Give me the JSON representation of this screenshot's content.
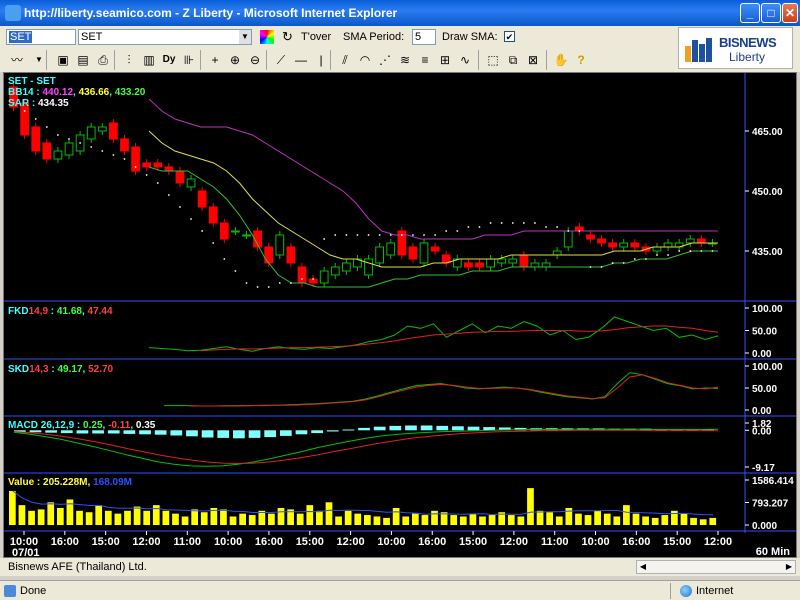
{
  "window": {
    "title": "http://liberty.seamico.com - Z Liberty - Microsoft Internet Explorer",
    "minimize": "_",
    "maximize": "□",
    "close": "✕"
  },
  "toolbar": {
    "symbol_input": "SET",
    "symbol_select": "SET",
    "tover_label": "T'over",
    "sma_period_label": "SMA Period:",
    "sma_period_value": "5",
    "draw_sma_label": "Draw SMA:",
    "draw_sma_checked": true,
    "icons": [
      "line-tool-icon",
      "dropdown-icon",
      "save-icon",
      "open-icon",
      "print-icon",
      "candle-icon",
      "bar-chart-icon",
      "date-icon",
      "crosshair-icon",
      "zoom-in-icon",
      "zoom-out-icon",
      "trendline-icon",
      "horizontal-line-icon",
      "vertical-line-icon",
      "parallel-lines-icon",
      "arc-icon",
      "fan-icon",
      "fibonacci-icon",
      "gann-icon",
      "cycle-icon",
      "select-icon",
      "copy-icon",
      "hand-icon",
      "help-icon"
    ]
  },
  "logo": {
    "brand": "BISNEWS",
    "sub": "Liberty"
  },
  "chart_data": [
    {
      "type": "line",
      "panel": "price",
      "labels": [
        "SET - SET",
        "BB14 : ",
        "SAR : "
      ],
      "legend": {
        "title": "SET - SET",
        "bb_label": "BB14 : ",
        "bb_values": [
          "440.12",
          "436.66",
          "433.20"
        ],
        "sar_label": "SAR : ",
        "sar_value": "434.35"
      },
      "y_ticks": [
        "465.00",
        "450.00",
        "435.00"
      ],
      "ylim": [
        424,
        478
      ],
      "candles": [
        {
          "o": 476,
          "c": 471
        },
        {
          "o": 472,
          "c": 464
        },
        {
          "o": 466,
          "c": 460
        },
        {
          "o": 462,
          "c": 458
        },
        {
          "o": 458,
          "c": 460
        },
        {
          "o": 459,
          "c": 462
        },
        {
          "o": 460,
          "c": 464
        },
        {
          "o": 463,
          "c": 466
        },
        {
          "o": 465,
          "c": 466
        },
        {
          "o": 467,
          "c": 463
        },
        {
          "o": 463,
          "c": 460
        },
        {
          "o": 461,
          "c": 455
        },
        {
          "o": 457,
          "c": 456
        },
        {
          "o": 457,
          "c": 456
        },
        {
          "o": 456,
          "c": 455
        },
        {
          "o": 455,
          "c": 452
        },
        {
          "o": 451,
          "c": 453
        },
        {
          "o": 450,
          "c": 446
        },
        {
          "o": 446,
          "c": 442
        },
        {
          "o": 442,
          "c": 438
        },
        {
          "o": 440,
          "c": 440
        },
        {
          "o": 439,
          "c": 439
        },
        {
          "o": 440,
          "c": 436
        },
        {
          "o": 436,
          "c": 432
        },
        {
          "o": 434,
          "c": 439
        },
        {
          "o": 436,
          "c": 432
        },
        {
          "o": 431,
          "c": 427
        },
        {
          "o": 428,
          "c": 427
        },
        {
          "o": 427,
          "c": 430
        },
        {
          "o": 429,
          "c": 431
        },
        {
          "o": 430,
          "c": 432
        },
        {
          "o": 431,
          "c": 433
        },
        {
          "o": 429,
          "c": 433
        },
        {
          "o": 432,
          "c": 436
        },
        {
          "o": 434,
          "c": 437
        },
        {
          "o": 440,
          "c": 434
        },
        {
          "o": 436,
          "c": 433
        },
        {
          "o": 432,
          "c": 437
        },
        {
          "o": 436,
          "c": 435
        },
        {
          "o": 434,
          "c": 432
        },
        {
          "o": 431,
          "c": 433
        },
        {
          "o": 432,
          "c": 431
        },
        {
          "o": 432,
          "c": 431
        },
        {
          "o": 431,
          "c": 433
        },
        {
          "o": 432,
          "c": 433
        },
        {
          "o": 432,
          "c": 433
        },
        {
          "o": 434,
          "c": 431
        },
        {
          "o": 431,
          "c": 432
        },
        {
          "o": 431,
          "c": 432
        },
        {
          "o": 434,
          "c": 435
        },
        {
          "o": 436,
          "c": 440
        },
        {
          "o": 441,
          "c": 440
        },
        {
          "o": 439,
          "c": 438
        },
        {
          "o": 438,
          "c": 437
        },
        {
          "o": 437,
          "c": 436
        },
        {
          "o": 436,
          "c": 437
        },
        {
          "o": 437,
          "c": 436
        },
        {
          "o": 436,
          "c": 435
        },
        {
          "o": 435,
          "c": 436
        },
        {
          "o": 436,
          "c": 437
        },
        {
          "o": 436,
          "c": 437
        },
        {
          "o": 437,
          "c": 438
        },
        {
          "o": 438,
          "c": 437
        },
        {
          "o": 437,
          "c": 437
        }
      ],
      "bb_upper": [
        null,
        null,
        null,
        null,
        null,
        null,
        null,
        null,
        null,
        null,
        null,
        null,
        null,
        null,
        null,
        null,
        null,
        null,
        null,
        null,
        null,
        null,
        null,
        null,
        null,
        null,
        null,
        null,
        null,
        null,
        null,
        null,
        null,
        null,
        null,
        null,
        null,
        null,
        null,
        null,
        null,
        null,
        null,
        null,
        null,
        null,
        null,
        null,
        null,
        null,
        null,
        null,
        null,
        null,
        null,
        null,
        null,
        null,
        null,
        null,
        null,
        null,
        null,
        null
      ],
      "bb_upper_series": [
        473,
        470,
        468,
        467,
        466,
        466,
        466,
        465,
        464,
        462,
        460,
        458,
        456,
        454,
        452,
        450,
        447,
        443,
        440,
        439,
        439,
        438,
        438,
        438,
        438,
        438,
        439,
        439,
        439,
        440,
        440,
        440,
        440,
        440,
        440,
        440,
        440,
        440,
        440,
        440,
        440,
        440,
        440,
        440,
        440
      ],
      "bb_mid_series": [
        465,
        462,
        460,
        459,
        458,
        457,
        455,
        452,
        448,
        445,
        442,
        440,
        438,
        436,
        434,
        433,
        433,
        432,
        431,
        431,
        431,
        431,
        432,
        432,
        433,
        433,
        433,
        433,
        434,
        434,
        434,
        434,
        434,
        434,
        434,
        434,
        435,
        435,
        435,
        436,
        436,
        436,
        437,
        437,
        437
      ],
      "bb_lower_series": [
        456,
        455,
        455,
        455,
        453,
        451,
        448,
        444,
        439,
        433,
        429,
        427,
        427,
        426,
        426,
        426,
        426,
        426,
        427,
        428,
        428,
        429,
        429,
        429,
        429,
        430,
        430,
        430,
        431,
        431,
        431,
        431,
        431,
        431,
        431,
        431,
        432,
        432,
        433,
        433,
        433,
        434,
        435,
        435,
        435
      ],
      "sar_series": [
        472,
        470,
        468,
        466,
        464,
        463,
        462,
        461,
        460,
        459,
        458,
        456,
        454,
        452,
        449,
        446,
        443,
        440,
        437,
        433,
        430,
        427,
        426,
        426,
        427,
        427,
        428,
        428,
        438,
        439,
        439,
        439,
        439,
        439,
        439,
        439,
        439,
        439,
        439,
        440,
        440,
        441,
        441,
        442,
        442,
        442,
        442,
        442,
        441,
        441,
        440,
        440,
        431,
        431,
        432,
        432,
        433,
        433,
        434,
        434,
        435,
        435,
        435,
        435
      ]
    },
    {
      "type": "line",
      "panel": "FKD",
      "legend": {
        "name": "FKD",
        "params": "14,9",
        "sep": " : ",
        "v1": "41.68",
        "v2": "47.44"
      },
      "y_ticks": [
        "100.00",
        "50.00",
        "0.00"
      ],
      "ylim": [
        0,
        100
      ],
      "series": [
        {
          "name": "41.68",
          "color": "#00c000",
          "values": [
            12,
            10,
            8,
            5,
            6,
            10,
            14,
            8,
            4,
            10,
            14,
            10,
            8,
            12,
            10,
            14,
            18,
            25,
            30,
            40,
            60,
            55,
            65,
            35,
            50,
            65,
            45,
            60,
            55,
            70,
            60,
            40,
            50,
            30,
            35,
            55,
            80,
            70,
            60,
            50,
            55,
            35,
            40,
            30,
            38
          ]
        },
        {
          "name": "47.44",
          "color": "#e02020",
          "values": [
            null,
            null,
            null,
            null,
            5,
            7,
            8,
            9,
            9,
            10,
            11,
            12,
            12,
            13,
            14,
            15,
            17,
            20,
            23,
            27,
            32,
            36,
            40,
            42,
            44,
            46,
            47,
            48,
            48,
            49,
            50,
            50,
            50,
            49,
            48,
            49,
            52,
            56,
            58,
            60,
            60,
            57,
            55,
            50,
            46
          ]
        }
      ]
    },
    {
      "type": "line",
      "panel": "SKD",
      "legend": {
        "name": "SKD",
        "params": "14,3",
        "sep": " : ",
        "v1": "49.17",
        "v2": "52.70"
      },
      "y_ticks": [
        "100.00",
        "50.00",
        "0.00"
      ],
      "ylim": [
        0,
        100
      ],
      "series": [
        {
          "name": "49.17",
          "color": "#00c000",
          "values": [
            10,
            10,
            10,
            9,
            9,
            10,
            10,
            10,
            11,
            11,
            12,
            13,
            14,
            16,
            18,
            20,
            25,
            32,
            40,
            48,
            55,
            58,
            60,
            55,
            50,
            48,
            50,
            52,
            50,
            46,
            40,
            35,
            30,
            28,
            25,
            30,
            60,
            85,
            80,
            70,
            60,
            55,
            48,
            50,
            49
          ]
        },
        {
          "name": "52.70",
          "color": "#e02020",
          "values": [
            null,
            null,
            9,
            9,
            9,
            9,
            9,
            10,
            10,
            11,
            11,
            12,
            13,
            15,
            17,
            19,
            23,
            30,
            38,
            45,
            52,
            56,
            58,
            56,
            52,
            49,
            49,
            50,
            50,
            47,
            42,
            37,
            32,
            29,
            26,
            28,
            50,
            75,
            80,
            72,
            62,
            56,
            50,
            48,
            52
          ]
        }
      ]
    },
    {
      "type": "bar",
      "panel": "MACD",
      "legend": {
        "name": "MACD",
        "params": " 26,12,9",
        "sep": " : ",
        "v1": "0.25",
        "v2": "-0.11",
        "v3": "0.35"
      },
      "y_ticks": [
        "1.82",
        "0.00",
        "-9.17"
      ],
      "ylim": [
        -9.17,
        1.82
      ],
      "histogram": [
        -0.4,
        -0.5,
        -0.6,
        -0.7,
        -0.8,
        -0.8,
        -0.8,
        -0.9,
        -1.0,
        -1.1,
        -1.3,
        -1.5,
        -1.8,
        -1.9,
        -2.0,
        -1.9,
        -1.7,
        -1.4,
        -1.0,
        -0.7,
        -0.3,
        0.2,
        0.6,
        0.9,
        1.1,
        1.2,
        1.2,
        1.1,
        1.0,
        0.9,
        0.8,
        0.7,
        0.6,
        0.5,
        0.5,
        0.5,
        0.5,
        0.5,
        0.4,
        0.4,
        0.4,
        0.3,
        0.3,
        0.3,
        0.3
      ],
      "series": [
        {
          "name": "0.25",
          "color": "#00c000",
          "values": [
            -0.5,
            -1.0,
            -1.6,
            -2.3,
            -3.2,
            -4.1,
            -5.1,
            -6.1,
            -7.0,
            -7.9,
            -8.5,
            -8.9,
            -9.0,
            -8.9,
            -8.5,
            -7.9,
            -7.1,
            -6.2,
            -5.3,
            -4.3,
            -3.5,
            -2.7,
            -2.0,
            -1.4,
            -1.0,
            -0.7,
            -0.5,
            -0.3,
            -0.2,
            -0.1,
            0.0,
            0.1,
            0.2,
            0.2,
            0.2,
            0.3,
            0.3,
            0.3,
            0.3,
            0.3,
            0.2,
            0.2,
            0.2,
            0.2,
            0.25
          ]
        },
        {
          "name": "-0.11",
          "color": "#e02020",
          "values": [
            -0.3,
            -0.6,
            -1.0,
            -1.5,
            -2.1,
            -2.8,
            -3.6,
            -4.5,
            -5.3,
            -6.1,
            -6.8,
            -7.4,
            -7.9,
            -8.2,
            -8.3,
            -8.2,
            -7.9,
            -7.4,
            -6.8,
            -6.1,
            -5.3,
            -4.6,
            -3.8,
            -3.1,
            -2.5,
            -1.9,
            -1.5,
            -1.1,
            -0.8,
            -0.6,
            -0.4,
            -0.3,
            -0.2,
            -0.1,
            -0.1,
            0.0,
            0.0,
            0.0,
            0.0,
            0.0,
            -0.1,
            -0.1,
            -0.1,
            -0.1,
            -0.11
          ]
        }
      ]
    },
    {
      "type": "bar",
      "panel": "Value",
      "legend": {
        "name": "Value",
        "sep": " : ",
        "v1": "205.228M",
        "v2": "168.09M"
      },
      "y_ticks": [
        "1586.414",
        "793.207",
        "0.000"
      ],
      "ylim": [
        0,
        1586.414
      ],
      "values": [
        1200,
        700,
        500,
        550,
        800,
        600,
        900,
        500,
        450,
        700,
        500,
        400,
        500,
        650,
        500,
        700,
        500,
        400,
        300,
        550,
        450,
        600,
        550,
        300,
        400,
        350,
        500,
        400,
        600,
        550,
        400,
        700,
        500,
        800,
        300,
        500,
        400,
        350,
        300,
        250,
        600,
        300,
        400,
        350,
        500,
        450,
        350,
        300,
        400,
        300,
        350,
        450,
        350,
        300,
        1300,
        500,
        450,
        300,
        600,
        400,
        350,
        500,
        400,
        300,
        700,
        400,
        300,
        250,
        350,
        500,
        400,
        250,
        200,
        250
      ],
      "series": [
        {
          "name": "168.09M",
          "color": "#3050ff"
        }
      ]
    }
  ],
  "x_axis": {
    "ticks": [
      "10:00",
      "16:00",
      "15:00",
      "12:00",
      "11:00",
      "10:00",
      "16:00",
      "15:00",
      "12:00",
      "10:00",
      "16:00",
      "15:00",
      "12:00",
      "11:00",
      "10:00",
      "16:00",
      "15:00",
      "12:00"
    ],
    "date_label": "07/01",
    "interval_label": "60 Min"
  },
  "footer": {
    "text": "Bisnews AFE (Thailand) Ltd."
  },
  "status": {
    "left": "Done",
    "zone": "Internet"
  },
  "colors": {
    "bb_upper": "#c030c0",
    "bb_mid": "#e0e040",
    "bb_lower": "#30c030",
    "sar": "#ffffff",
    "up_candle": "#00c000",
    "down_candle": "#ff0000",
    "label_cyan": "#40ffff",
    "label_magenta": "#ff40ff",
    "label_yellow": "#ffff40",
    "label_green": "#40ff40",
    "label_red": "#ff4040",
    "label_blue": "#3050ff",
    "volume_bar": "#ffff00",
    "macd_hist": "#80ffff"
  }
}
